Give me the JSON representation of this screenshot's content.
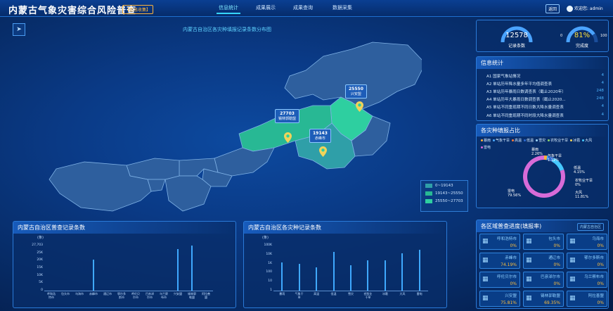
{
  "header": {
    "title": "内蒙古气象灾害综合风险普查",
    "tag": "【信息收集】",
    "tabs": [
      "信息统计",
      "成果展示",
      "成果查询",
      "数据采集"
    ],
    "active_tab": 0,
    "back_label": "返回",
    "user_label": "欢迎您: admin"
  },
  "map": {
    "title": "内蒙古自治区各灾种填报记录条数分布图",
    "labels": [
      {
        "value": "27703",
        "name": "锡林郭勒盟"
      },
      {
        "value": "25550",
        "name": "兴安盟"
      },
      {
        "value": "19143",
        "name": "赤峰市"
      }
    ],
    "legend": [
      {
        "label": "0~19143",
        "color": "#2f9fa8"
      },
      {
        "label": "19143~25550",
        "color": "#28b894"
      },
      {
        "label": "25550~27703",
        "color": "#2ecfa0"
      }
    ],
    "region_colors": {
      "base": "#2e5f9e",
      "border": "#7fb2e6"
    }
  },
  "gauges": {
    "records": {
      "value": "12578",
      "label": "记录条数"
    },
    "completion": {
      "value": "81%",
      "label": "完成度",
      "min": "0",
      "max": "100",
      "fraction": 0.81
    }
  },
  "info_stats": {
    "title": "信息统计",
    "rows": [
      {
        "name": "A1 国家气象站情况",
        "count": "4"
      },
      {
        "name": "A2 单站历年降水量多年平均值调查表",
        "count": "4"
      },
      {
        "name": "A3 单站历年暴雨日数调查表（截止2020年）",
        "count": "248"
      },
      {
        "name": "A4 单站历年大暴雨日数调查表（截止2020...",
        "count": "248"
      },
      {
        "name": "A5 单站不同重现期不同日数大降水量调查表",
        "count": "4"
      },
      {
        "name": "A6 单站不同重现期不同时段大降水量调查表",
        "count": "4"
      }
    ]
  },
  "pie": {
    "title": "各灾种填报占比",
    "legend": [
      "暴雨",
      "气象干旱",
      "高温",
      "低温",
      "雪灾",
      "农牧业干旱",
      "冰雹",
      "大风",
      "雷电"
    ],
    "slices": [
      {
        "name": "暴雨",
        "pct": "2.26%",
        "color": "#ffb23a",
        "value": 2.26
      },
      {
        "name": "气象干旱",
        "pct": "1.12%",
        "color": "#4aa8ff",
        "value": 1.12
      },
      {
        "name": "低温",
        "pct": "4.15%",
        "color": "#2d6ad1",
        "value": 4.15
      },
      {
        "name": "农牧业干旱",
        "pct": "0%",
        "color": "#8bd46b",
        "value": 0
      },
      {
        "name": "大风",
        "pct": "11.81%",
        "color": "#46c8ff",
        "value": 11.81
      },
      {
        "name": "雷电",
        "pct": "79.56%",
        "color": "#d76bd8",
        "value": 79.56
      }
    ]
  },
  "chart_data": [
    {
      "type": "bar",
      "title": "内蒙古自治区普查记录条数",
      "ylabel": "(条)",
      "yticks": [
        "27,703",
        "25K",
        "20K",
        "15K",
        "10K",
        "5K",
        "0"
      ],
      "ylim": [
        0,
        27703
      ],
      "categories": [
        "呼和浩特市",
        "包头市",
        "乌海市",
        "赤峰市",
        "通辽市",
        "鄂尔多斯市",
        "呼伦贝尔市",
        "巴彦淖尔市",
        "乌兰察布市",
        "兴安盟",
        "锡林郭勒盟",
        "阿拉善盟"
      ],
      "values": [
        0,
        0,
        0,
        19143,
        0,
        0,
        0,
        0,
        0,
        25550,
        27703,
        0
      ]
    },
    {
      "type": "bar",
      "title": "内蒙古自治区各灾种记录条数",
      "ylabel": "(条)",
      "yticks": [
        "100K",
        "10K",
        "1K",
        "100",
        "10",
        "1"
      ],
      "yscale": "log",
      "categories": [
        "暴雨",
        "气象干旱",
        "高温",
        "低温",
        "雪灾",
        "农牧业干旱",
        "冰雹",
        "大风",
        "雷电"
      ],
      "values": [
        1400,
        900,
        350,
        20000,
        600,
        2300,
        2100,
        15000,
        35000
      ]
    }
  ],
  "region_progress": {
    "title": "各区域普查进度(填报率)",
    "button": "内蒙古自治区",
    "cells": [
      {
        "name": "呼和浩特市",
        "value": "0%"
      },
      {
        "name": "包头市",
        "value": "0%"
      },
      {
        "name": "乌海市",
        "value": "0%"
      },
      {
        "name": "赤峰市",
        "value": "74.19%"
      },
      {
        "name": "通辽市",
        "value": "0%"
      },
      {
        "name": "鄂尔多斯市",
        "value": "0%"
      },
      {
        "name": "呼伦贝尔市",
        "value": "0%"
      },
      {
        "name": "巴彦淖尔市",
        "value": "0%"
      },
      {
        "name": "乌兰察布市",
        "value": "0%"
      },
      {
        "name": "兴安盟",
        "value": "75.81%"
      },
      {
        "name": "锡林郭勒盟",
        "value": "69.35%"
      },
      {
        "name": "阿拉善盟",
        "value": "0%"
      }
    ]
  }
}
